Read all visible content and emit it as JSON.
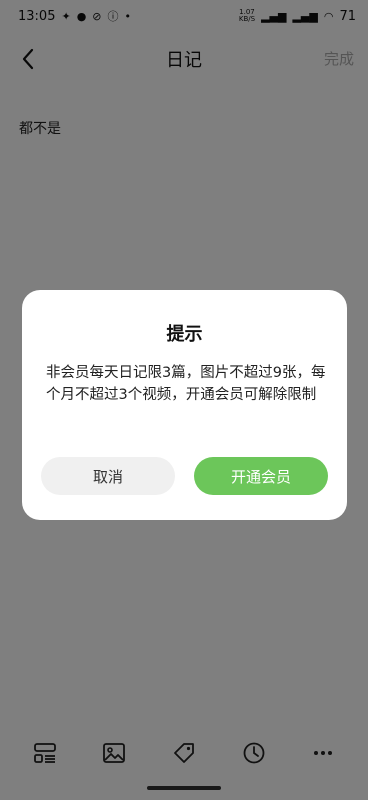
{
  "status": {
    "time": "13:05",
    "speed_top": "1.07",
    "speed_bottom": "KB/S",
    "battery": "71"
  },
  "nav": {
    "title": "日记",
    "done_label": "完成"
  },
  "editor": {
    "content": "都不是"
  },
  "dialog": {
    "title": "提示",
    "message": "非会员每天日记限3篇，图片不超过9张，每个月不超过3个视频，开通会员可解除限制",
    "cancel_label": "取消",
    "confirm_label": "开通会员",
    "confirm_color": "#6cc65a"
  },
  "toolbar": {
    "icons": [
      "template-icon",
      "image-icon",
      "tag-icon",
      "clock-icon",
      "more-icon"
    ]
  }
}
